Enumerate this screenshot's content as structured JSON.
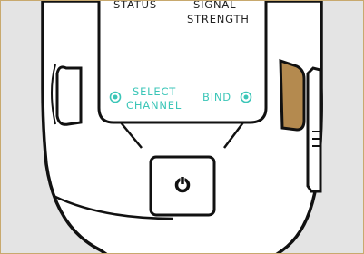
{
  "labels": {
    "status": "STATUS",
    "signal_line1": "SIGNAL",
    "signal_line2": "STRENGTH",
    "select_line1": "SELECT",
    "select_line2": "CHANNEL",
    "bind": "BIND"
  },
  "colors": {
    "background": "#e4e4e4",
    "frame_border": "#c8a96e",
    "device_body": "#ffffff",
    "outline": "#111111",
    "accent_teal": "#3cc6b8",
    "side_button": "#b48a4f",
    "text_dark": "#222222"
  },
  "icons": {
    "power": "power-icon",
    "select_indicator": "radio-dot-icon",
    "bind_indicator": "radio-dot-icon"
  }
}
